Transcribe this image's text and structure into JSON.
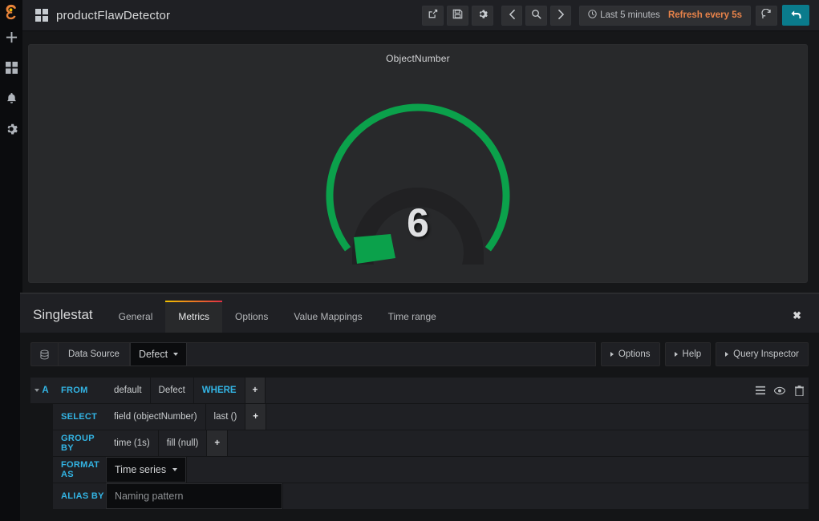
{
  "colors": {
    "page_bg": "#161719",
    "panel_bg": "#28292b",
    "accent_blue": "#33b5e5",
    "gauge_green": "#0ba14b",
    "refresh_orange": "#e8834a",
    "tab_gradient_start": "#f2c200",
    "tab_gradient_end": "#e02f44",
    "action_button_blue": "#0a7b8c"
  },
  "sidebar": {
    "brand_icon": "grafana-logo-icon",
    "items": [
      {
        "icon": "plus-icon",
        "name": "create"
      },
      {
        "icon": "dashboards-grid-icon",
        "name": "dashboards"
      },
      {
        "icon": "bell-icon",
        "name": "alerting"
      },
      {
        "icon": "gear-icon",
        "name": "configuration"
      }
    ]
  },
  "topnav": {
    "dashboard_icon": "dashboard-grid-icon",
    "title": "productFlawDetector",
    "buttons": [
      {
        "icon": "share-icon",
        "name": "share-dashboard"
      },
      {
        "icon": "save-icon",
        "name": "save-dashboard"
      },
      {
        "icon": "gear-icon",
        "name": "dashboard-settings"
      }
    ],
    "nav_buttons": [
      {
        "icon": "chevron-left-icon",
        "name": "time-shift-back"
      },
      {
        "icon": "search-icon",
        "name": "zoom-out-time"
      },
      {
        "icon": "chevron-right-icon",
        "name": "time-shift-forward"
      }
    ],
    "time_picker": {
      "clock_icon": "clock-icon",
      "range": "Last 5 minutes",
      "refresh": "Refresh every 5s"
    },
    "refresh_icon": "refresh-icon",
    "back_icon": "back-arrow-icon"
  },
  "panel": {
    "title": "ObjectNumber",
    "value": "6"
  },
  "chart_data": {
    "type": "gauge",
    "title": "ObjectNumber",
    "value": 6,
    "min": 0,
    "max": 100,
    "unit": "",
    "threshold_color": "#0ba14b",
    "start_angle_deg": -200,
    "end_angle_deg": 20,
    "needle_angle_deg": -194,
    "series": [
      {
        "name": "ObjectNumber",
        "values": [
          6
        ]
      }
    ]
  },
  "editor": {
    "panel_type": "Singlestat",
    "tabs": [
      {
        "label": "General",
        "active": false
      },
      {
        "label": "Metrics",
        "active": true
      },
      {
        "label": "Options",
        "active": false
      },
      {
        "label": "Value Mappings",
        "active": false
      },
      {
        "label": "Time range",
        "active": false
      }
    ],
    "close_label": "✖",
    "datasource_row": {
      "icon": "database-icon",
      "label": "Data Source",
      "selected": "Defect",
      "actions": [
        {
          "label": "Options",
          "name": "options-toggle"
        },
        {
          "label": "Help",
          "name": "help-toggle"
        },
        {
          "label": "Query Inspector",
          "name": "query-inspector-toggle"
        }
      ]
    },
    "query": {
      "ref_id": "A",
      "rows": [
        {
          "label": "FROM",
          "segments": [
            {
              "text": "default",
              "style": "plain"
            },
            {
              "text": "Defect",
              "style": "plain"
            },
            {
              "text": "WHERE",
              "style": "keyword"
            },
            {
              "text": "+",
              "style": "plus"
            }
          ]
        },
        {
          "label": "SELECT",
          "segments": [
            {
              "text": "field (objectNumber)",
              "style": "plain"
            },
            {
              "text": "last ()",
              "style": "plain"
            },
            {
              "text": "+",
              "style": "plus"
            }
          ]
        },
        {
          "label": "GROUP BY",
          "segments": [
            {
              "text": "time (1s)",
              "style": "plain"
            },
            {
              "text": "fill (null)",
              "style": "plain"
            },
            {
              "text": "+",
              "style": "plus"
            }
          ]
        },
        {
          "label": "FORMAT AS",
          "segments": [
            {
              "text": "Time series",
              "style": "select"
            }
          ]
        },
        {
          "label": "ALIAS BY",
          "segments": [
            {
              "text": "",
              "style": "input",
              "placeholder": "Naming pattern"
            }
          ]
        }
      ],
      "row_icons": [
        {
          "icon": "hamburger-icon",
          "name": "toggle-text-edit-mode"
        },
        {
          "icon": "eye-icon",
          "name": "toggle-query-visibility"
        },
        {
          "icon": "trash-icon",
          "name": "remove-query"
        }
      ]
    }
  }
}
